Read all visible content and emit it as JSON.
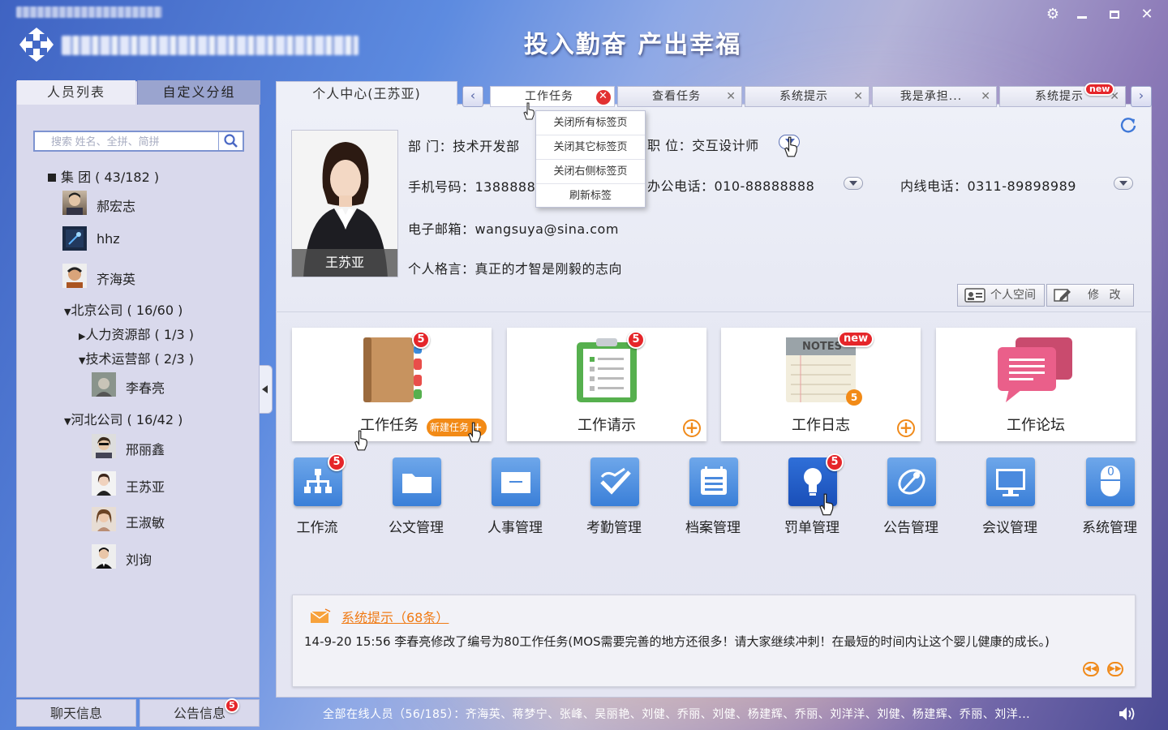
{
  "header": {
    "slogan": "投入勤奋 产出幸福"
  },
  "left_panel": {
    "tabs": [
      "人员列表",
      "自定义分组"
    ],
    "search_placeholder": "搜索 姓名、全拼、简拼",
    "tree": [
      {
        "label": "集 团 ( 43/182 )"
      },
      {
        "label": "北京公司 ( 16/60 )"
      },
      {
        "label": "人力资源部 ( 1/3 )"
      },
      {
        "label": "技术运营部 ( 2/3 )"
      },
      {
        "label": "河北公司 ( 16/42 )"
      }
    ],
    "people": [
      "郝宏志",
      "hhz",
      "齐海英",
      "李春亮",
      "邢丽鑫",
      "王苏亚",
      "王淑敏",
      "刘询"
    ],
    "bottom": {
      "chat": "聊天信息",
      "notice": "公告信息",
      "notice_badge": "5"
    }
  },
  "tabs": {
    "personal": "个人中心(王苏亚)",
    "items": [
      {
        "label": "工作任务"
      },
      {
        "label": "查看任务"
      },
      {
        "label": "系统提示"
      },
      {
        "label": "我是承担..."
      },
      {
        "label": "系统提示",
        "badge": "new"
      }
    ],
    "context_menu": [
      "关闭所有标签页",
      "关闭其它标签页",
      "关闭右侧标签页",
      "刷新标签"
    ]
  },
  "profile": {
    "name": "王苏亚",
    "dept": "部 门：技术开发部",
    "position": "职 位：交互设计师",
    "mobile": "手机号码：1388888",
    "office_phone": "办公电话：010-88888888",
    "ext_phone": "内线电话：0311-89898989",
    "email": "电子邮箱：wangsuya@sina.com",
    "motto": "个人格言：真正的才智是刚毅的志向",
    "space_btn": "个人空间",
    "edit_btn": "修 改"
  },
  "cards": [
    {
      "label": "工作任务",
      "badge": "5",
      "action": "新建任务"
    },
    {
      "label": "工作请示",
      "badge": "5"
    },
    {
      "label": "工作日志",
      "badge": "new",
      "small_badge": "5",
      "notes_text": "NOTES"
    },
    {
      "label": "工作论坛"
    }
  ],
  "apps": [
    {
      "label": "工作流",
      "badge": "5"
    },
    {
      "label": "公文管理"
    },
    {
      "label": "人事管理"
    },
    {
      "label": "考勤管理"
    },
    {
      "label": "档案管理"
    },
    {
      "label": "罚单管理",
      "badge": "5"
    },
    {
      "label": "公告管理"
    },
    {
      "label": "会议管理"
    },
    {
      "label": "系统管理",
      "tile_text": "0"
    }
  ],
  "notice": {
    "title": "系统提示（68条）",
    "text": "14-9-20  15:56   李春亮修改了编号为80工作任务(MOS需要完善的地方还很多！请大家继续冲刺！在最短的时间内让这个婴儿健康的成长。)"
  },
  "status_bar": {
    "online": "全部在线人员（56/185）：齐海英、蒋梦宁、张峰、吴丽艳、刘健、乔丽、刘健、杨建辉、乔丽、刘洋洋、刘健、杨建辉、乔丽、刘洋..."
  },
  "colors": {
    "accent": "#f08a1a",
    "badge": "#e5262a",
    "tile": "#4a8ade"
  }
}
